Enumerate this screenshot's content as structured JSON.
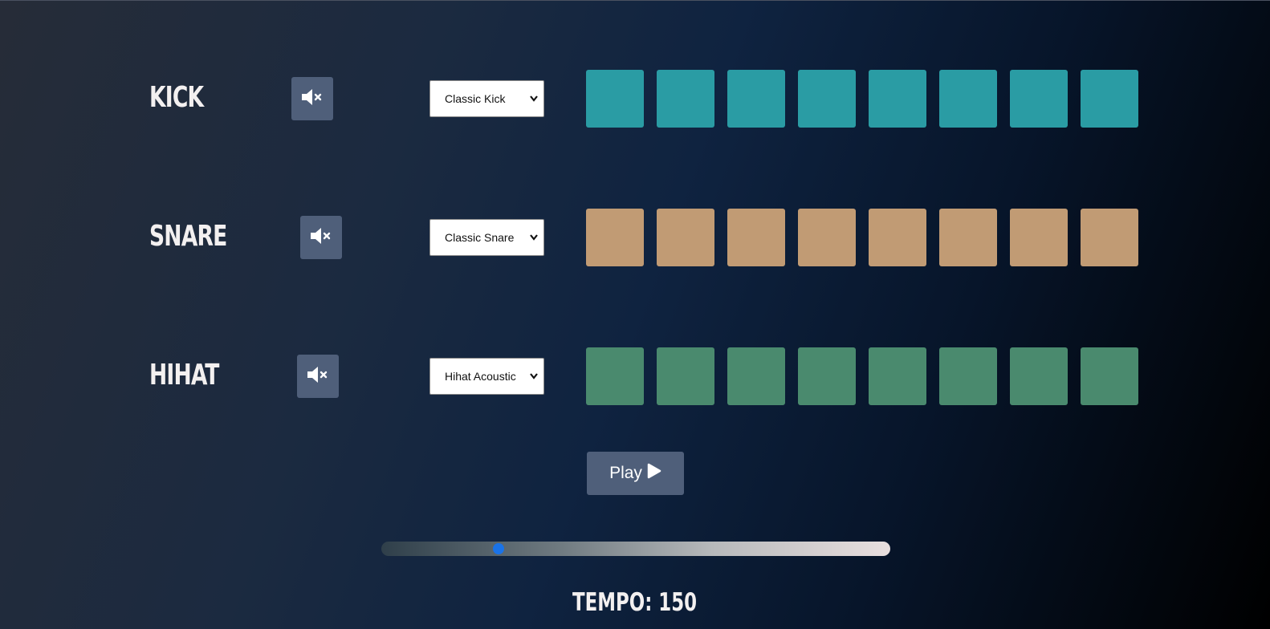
{
  "tracks": [
    {
      "name": "KICK",
      "sound": "Classic Kick",
      "pad_color": "#2a9ca4",
      "pads": 8,
      "mute_icon": "speaker-mute-icon"
    },
    {
      "name": "SNARE",
      "sound": "Classic Snare",
      "pad_color": "#c19b74",
      "pads": 8,
      "mute_icon": "speaker-mute-icon"
    },
    {
      "name": "HIHAT",
      "sound": "Hihat Acoustic",
      "pad_color": "#4a8a6e",
      "pads": 8,
      "mute_icon": "speaker-mute-icon"
    }
  ],
  "controls": {
    "play_label": "Play",
    "play_icon": "play-icon",
    "tempo_label": "TEMPO: 150",
    "tempo_value": 150,
    "tempo_min": 20,
    "tempo_max": 600
  },
  "colors": {
    "button_bg": "#4f5f7a",
    "slider_thumb": "#1a73e8"
  }
}
